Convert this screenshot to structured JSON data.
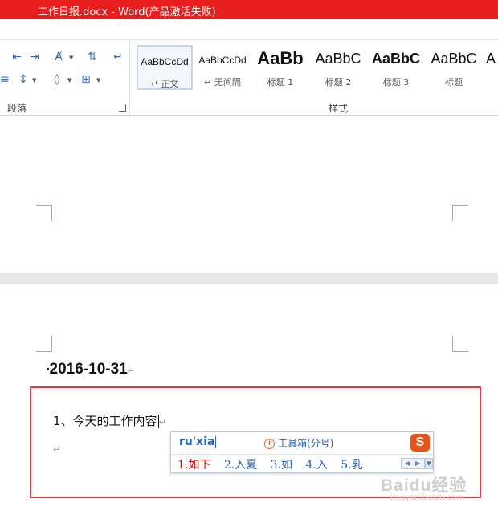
{
  "window": {
    "title": "工作日报.docx -  Word(产品激活失败)"
  },
  "ribbon": {
    "paragraph_group_label": "段落",
    "styles_group_label": "样式",
    "styles": [
      {
        "sample": "AaBbCcDd",
        "name": "↵ 正文",
        "selected": true
      },
      {
        "sample": "AaBbCcDd",
        "name": "↵ 无间隔"
      },
      {
        "sample": "AaBb",
        "name": "标题 1"
      },
      {
        "sample": "AaBbC",
        "name": "标题 2"
      },
      {
        "sample": "AaBbC",
        "name": "标题 3"
      },
      {
        "sample": "AaBbC",
        "name": "标题"
      },
      {
        "sample": "A",
        "name": ""
      }
    ]
  },
  "document": {
    "heading": "2016-10-31",
    "paragraph_mark": "↵",
    "line1": "1、今天的工作内容"
  },
  "ime": {
    "composition": "ru'xia",
    "toolbox_label": "工具箱(分号)",
    "candidates": [
      "1.如下",
      "2.入夏",
      "3.如",
      "4.入",
      "5.乳"
    ]
  },
  "watermark": {
    "text": "Baidu经验",
    "sub": "jingyan.baidu.com"
  },
  "colors": {
    "title_bar": "#e81d1d",
    "highlight_border": "#e23b3b",
    "ime_text": "#2367b5",
    "ime_first_candidate": "#e00000"
  }
}
